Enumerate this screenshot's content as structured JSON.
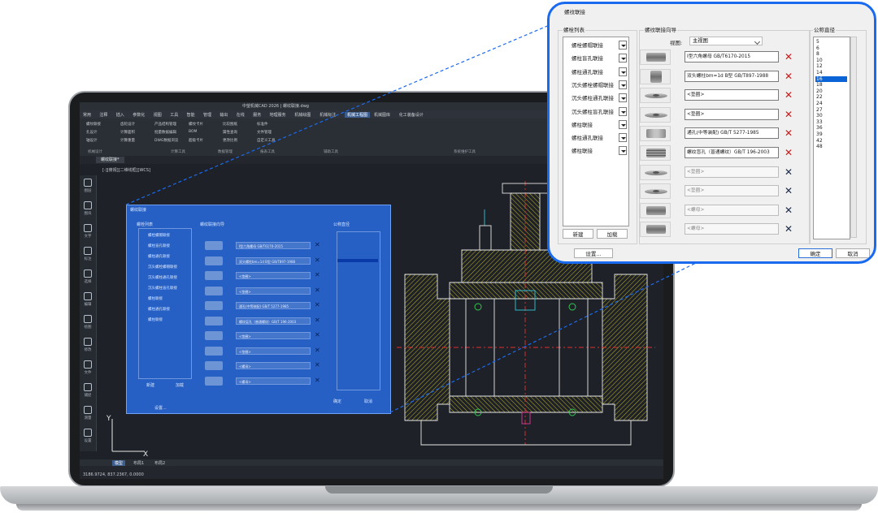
{
  "zoom": {
    "title": "螺纹联接",
    "joint_list": {
      "legend": "螺栓列表",
      "items": [
        "螺栓螺帽联接",
        "螺柱盲孔联接",
        "螺柱通孔联接",
        "沉头螺栓螺帽联接",
        "沉头螺柱通孔联接",
        "沉头螺柱盲孔联接",
        "螺柱联接",
        "螺柱通孔联接",
        "螺柱联接"
      ],
      "new_button": "新建",
      "load_button": "加载"
    },
    "wizard": {
      "legend": "螺纹联接向导",
      "view_label": "视图:",
      "view_value": "主视图",
      "parts": [
        {
          "text": "I型六角螺母 GB/T6170-2015",
          "state": "active",
          "icon": "hex-nut"
        },
        {
          "text": "双头螺柱bm=1d B型 GB/T897-1988",
          "state": "active",
          "icon": "stud-bolt"
        },
        {
          "text": "<垫圈>",
          "state": "active",
          "icon": "washer"
        },
        {
          "text": "<垫圈>",
          "state": "active",
          "icon": "washer"
        },
        {
          "text": "通孔(中等装配) GB/T 5277-1985",
          "state": "active",
          "icon": "through-hole"
        },
        {
          "text": "螺纹盲孔（普通螺纹）GB/T 196-2003",
          "state": "active",
          "icon": "threaded-hole"
        },
        {
          "text": "<垫圈>",
          "state": "inactive",
          "icon": "washer"
        },
        {
          "text": "<垫圈>",
          "state": "inactive",
          "icon": "washer"
        },
        {
          "text": "<螺母>",
          "state": "inactive",
          "icon": "hex-nut"
        },
        {
          "text": "<螺母>",
          "state": "inactive",
          "icon": "hex-nut"
        }
      ]
    },
    "diameter": {
      "legend": "公称直径",
      "values": [
        "5",
        "6",
        "8",
        "10",
        "12",
        "14",
        "16",
        "18",
        "20",
        "22",
        "24",
        "27",
        "30",
        "33",
        "36",
        "39",
        "42",
        "48"
      ],
      "selected": "16"
    },
    "settings_button": "设置...",
    "ok_button": "确定",
    "cancel_button": "取消"
  },
  "cad": {
    "title": "中望机械CAD 2026 | 螺纹联接.dwg",
    "menu": [
      "常用",
      "注释",
      "插入",
      "参数化",
      "视图",
      "工具",
      "智能",
      "管理",
      "输出",
      "在线",
      "服务",
      "地理服务",
      "机械绘图",
      "机械标注",
      "机械工程图",
      "机械图库",
      "化工装备设计"
    ],
    "active_menu": "机械工程图",
    "ribbon_groups": [
      "机械设计",
      "计算工具",
      "数据管理",
      "报表工具",
      "辅助工具",
      "系统维护工具"
    ],
    "ribbon_items": [
      "螺纹联接",
      "孔设计",
      "轴设计",
      "齿轮设计",
      "计算面积",
      "计算重量",
      "产品结构管理",
      "批量数据编辑",
      "DWG数据浏览",
      "螺纹卡片",
      "BOM",
      "超级卡片",
      "比较图纸",
      "属性查询",
      "更改比例",
      "标准件",
      "文件管理",
      "自定义工具"
    ],
    "doc_tab": "螺纹联接*",
    "view_label": "[-][俯视][二维线框][WCS]",
    "left_tools": [
      "图层",
      "图块",
      "文字",
      "标注",
      "选择",
      "编辑",
      "绘图",
      "修改",
      "文件",
      "捕捉",
      "测量",
      "设置"
    ],
    "layout_tabs": [
      "模型",
      "布局1",
      "布局2"
    ],
    "coords": "3186.9724, 837.2367, 0.0000"
  }
}
